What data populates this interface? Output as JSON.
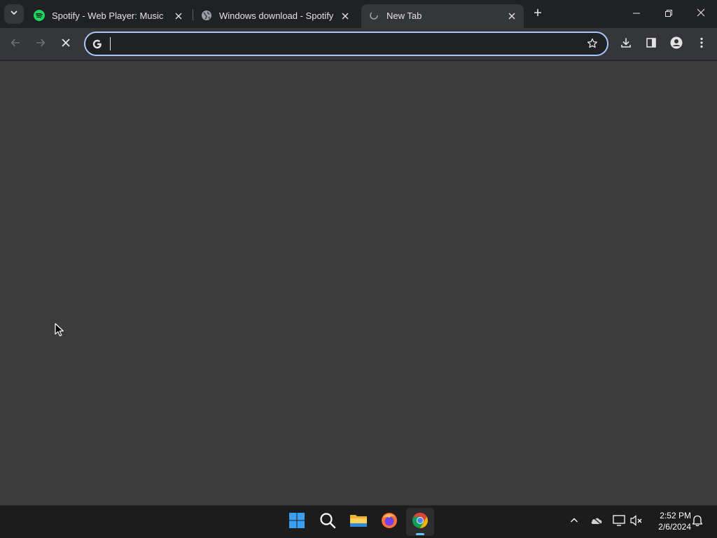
{
  "browser": {
    "tabs": [
      {
        "title": "Spotify - Web Player: Music for",
        "favicon": "spotify-icon",
        "active": false
      },
      {
        "title": "Windows download - Spotify",
        "favicon": "globe-icon",
        "active": false
      },
      {
        "title": "New Tab",
        "favicon": "loading-icon",
        "active": true
      }
    ],
    "window_controls": [
      "minimize",
      "restore",
      "close"
    ]
  },
  "toolbar": {
    "omnibox": {
      "value": "",
      "placeholder": ""
    },
    "accent_color": "#a8c7fa"
  },
  "page": {
    "background": "#3c3c3c"
  },
  "taskbar": {
    "apps": [
      "start-icon",
      "search-icon",
      "file-explorer-icon",
      "firefox-icon",
      "chrome-icon"
    ],
    "clock": {
      "time": "2:52 PM",
      "date": "2/6/2024"
    }
  }
}
